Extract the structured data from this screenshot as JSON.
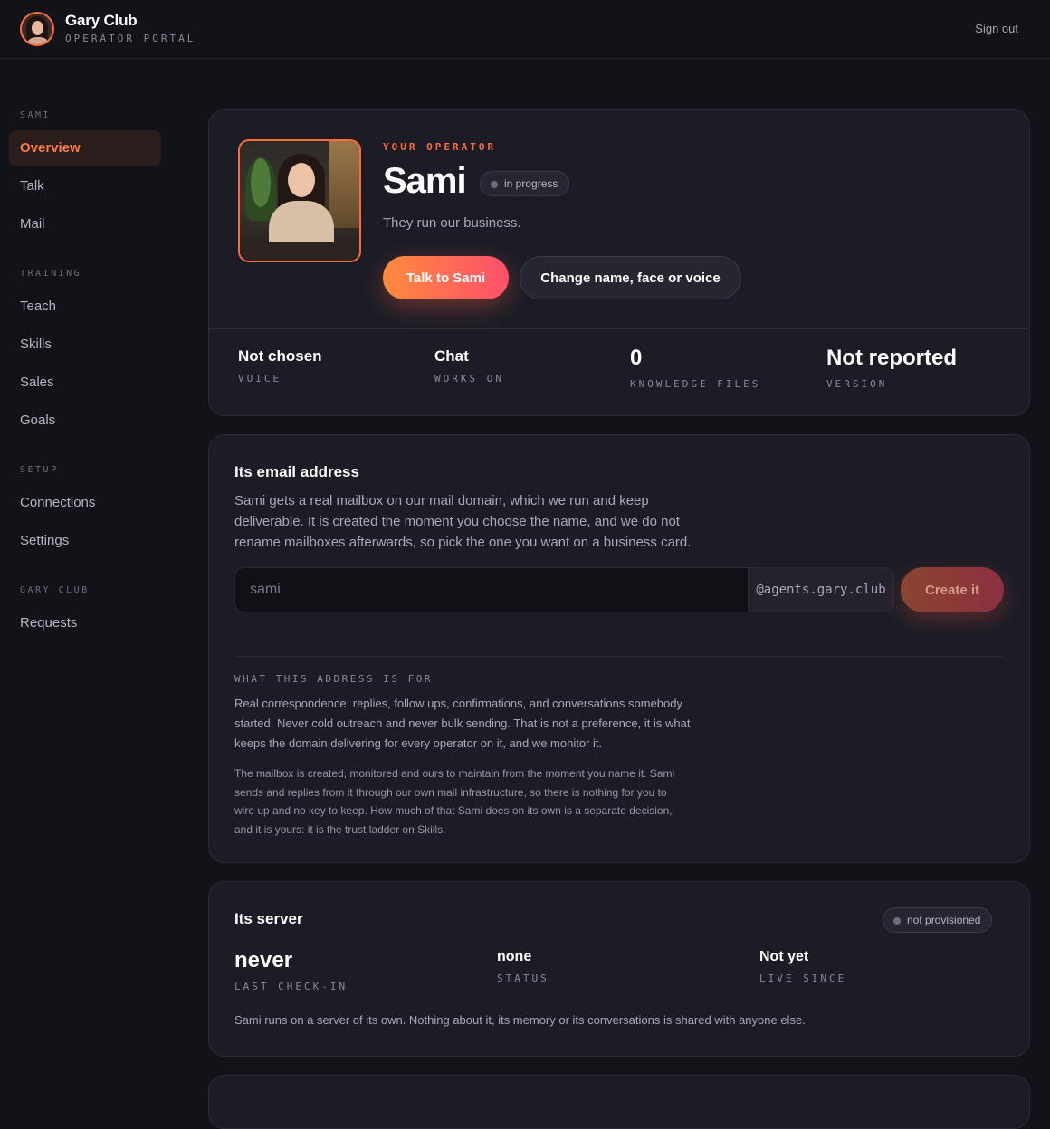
{
  "header": {
    "brand_name": "Gary Club",
    "brand_subtitle": "OPERATOR PORTAL",
    "signout_label": "Sign out"
  },
  "sidebar": {
    "sections": [
      {
        "title": "SAMI",
        "items": [
          "Overview",
          "Talk",
          "Mail"
        ]
      },
      {
        "title": "TRAINING",
        "items": [
          "Teach",
          "Skills",
          "Sales",
          "Goals"
        ]
      },
      {
        "title": "SETUP",
        "items": [
          "Connections",
          "Settings"
        ]
      },
      {
        "title": "GARY CLUB",
        "items": [
          "Requests"
        ]
      }
    ],
    "active_item": "Overview"
  },
  "hero": {
    "eyebrow": "YOUR OPERATOR",
    "name": "Sami",
    "status": "in progress",
    "tagline": "They run our business.",
    "primary_button": "Talk to Sami",
    "secondary_button": "Change name, face or voice",
    "stats": [
      {
        "value": "Not chosen",
        "label": "VOICE"
      },
      {
        "value": "Chat",
        "label": "WORKS ON"
      },
      {
        "value": "0",
        "label": "KNOWLEDGE FILES"
      },
      {
        "value": "Not reported",
        "label": "VERSION"
      }
    ]
  },
  "email": {
    "title": "Its email address",
    "description": "Sami gets a real mailbox on our mail domain, which we run and keep deliverable. It is created the moment you choose the name, and we do not rename mailboxes afterwards, so pick the one you want on a business card.",
    "input_placeholder": "sami",
    "domain_suffix": "@agents.gary.club",
    "create_button": "Create it",
    "purpose_heading": "WHAT THIS ADDRESS IS FOR",
    "purpose_text": "Real correspondence: replies, follow ups, confirmations, and conversations somebody started. Never cold outreach and never bulk sending. That is not a preference, it is what keeps the domain delivering for every operator on it, and we monitor it.",
    "ownership_text": "The mailbox is created, monitored and ours to maintain from the moment you name it. Sami sends and replies from it through our own mail infrastructure, so there is nothing for you to wire up and no key to keep. How much of that Sami does on its own is a separate decision, and it is yours: it is the trust ladder on Skills."
  },
  "server": {
    "title": "Its server",
    "status_badge": "not provisioned",
    "stats": [
      {
        "value": "never",
        "label": "LAST CHECK-IN"
      },
      {
        "value": "none",
        "label": "STATUS"
      },
      {
        "value": "Not yet",
        "label": "LIVE SINCE"
      }
    ],
    "note": "Sami runs on a server of its own. Nothing about it, its memory or its conversations is shared with anyone else."
  },
  "colors": {
    "accent": "#ff6a3d",
    "accent_gradient_end": "#ff4f6b",
    "background": "#121219",
    "card": "#1c1c26"
  }
}
